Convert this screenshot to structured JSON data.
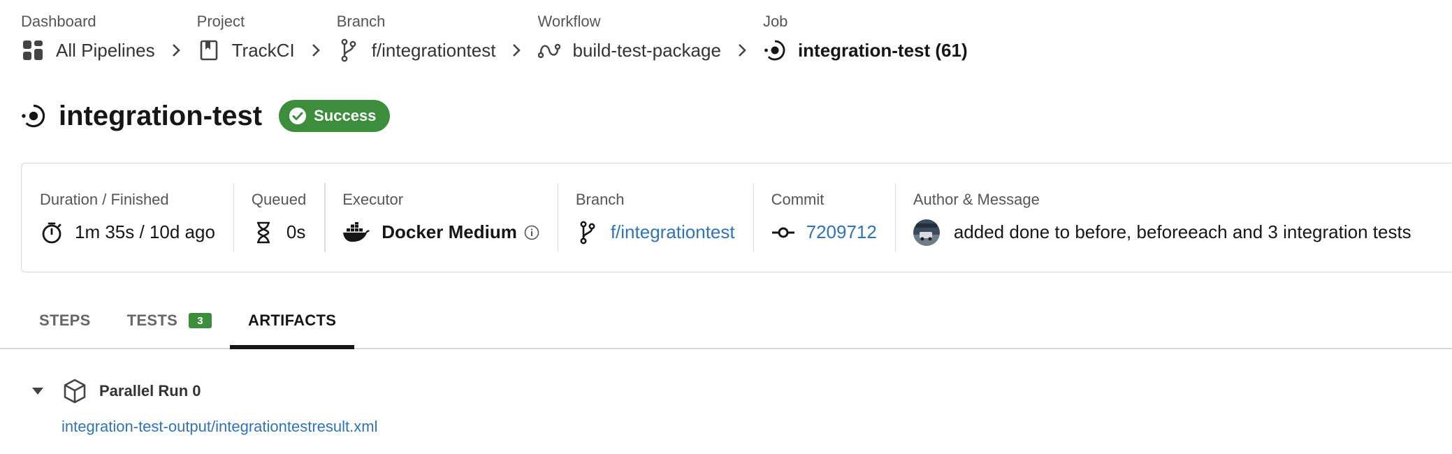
{
  "breadcrumb": {
    "dashboard": {
      "caption": "Dashboard",
      "label": "All Pipelines",
      "icon": "dashboard-icon"
    },
    "project": {
      "caption": "Project",
      "label": "TrackCI",
      "icon": "bookmark-icon"
    },
    "branch": {
      "caption": "Branch",
      "label": "f/integrationtest",
      "icon": "branch-icon"
    },
    "workflow": {
      "caption": "Workflow",
      "label": "build-test-package",
      "icon": "workflow-icon"
    },
    "job": {
      "caption": "Job",
      "label": "integration-test (61)",
      "icon": "job-icon"
    },
    "separator_icon": "chevron-right-icon"
  },
  "header": {
    "title": "integration-test",
    "icon": "job-icon",
    "status": "Success",
    "status_color": "#3c8e3c"
  },
  "info": {
    "duration": {
      "label": "Duration / Finished",
      "value": "1m 35s / 10d ago",
      "icon": "stopwatch-icon"
    },
    "queued": {
      "label": "Queued",
      "value": "0s",
      "icon": "hourglass-icon"
    },
    "executor": {
      "label": "Executor",
      "value": "Docker Medium",
      "icon": "docker-icon",
      "info_icon": "info-icon"
    },
    "branch": {
      "label": "Branch",
      "value": "f/integrationtest",
      "icon": "branch-icon"
    },
    "commit": {
      "label": "Commit",
      "value": "7209712",
      "icon": "commit-icon"
    },
    "author": {
      "label": "Author & Message",
      "message": "added done to before, beforeeach and 3 integration tests"
    }
  },
  "tabs": {
    "steps": "STEPS",
    "tests": "TESTS",
    "tests_count": "3",
    "artifacts": "ARTIFACTS",
    "active": "ARTIFACTS"
  },
  "artifacts": {
    "run_title": "Parallel Run 0",
    "items": [
      {
        "path": "integration-test-output/integrationtestresult.xml"
      }
    ]
  },
  "colors": {
    "link": "#2f73b8",
    "success": "#3c8e3c",
    "text": "#161616"
  }
}
